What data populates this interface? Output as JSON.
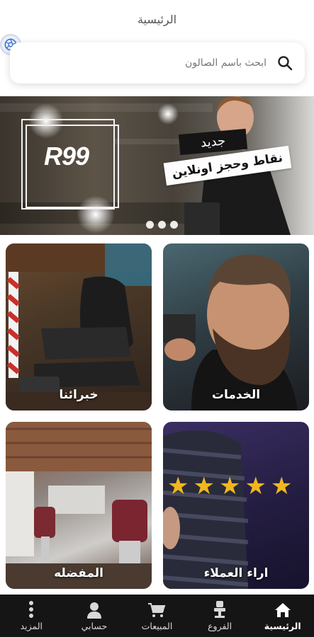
{
  "header": {
    "title": "الرئيسية"
  },
  "search": {
    "placeholder": "ابحث باسم الصالون"
  },
  "banner": {
    "logo_text": "R99",
    "badge_new": "جديد",
    "badge_points": "نقاط وحجز اونلاين",
    "slide_count": 3
  },
  "cards": {
    "services": "الخدمات",
    "experts": "خبرائنا",
    "reviews": "اراء العملاء",
    "favorite": "المفضله",
    "rating_stars": 5
  },
  "nav": {
    "home": "الرئيسية",
    "branches": "الفروع",
    "sales": "المبيعات",
    "account": "حسابي",
    "more": "المزيد"
  },
  "colors": {
    "nav_bg": "#151515",
    "star": "#f0b71f"
  }
}
